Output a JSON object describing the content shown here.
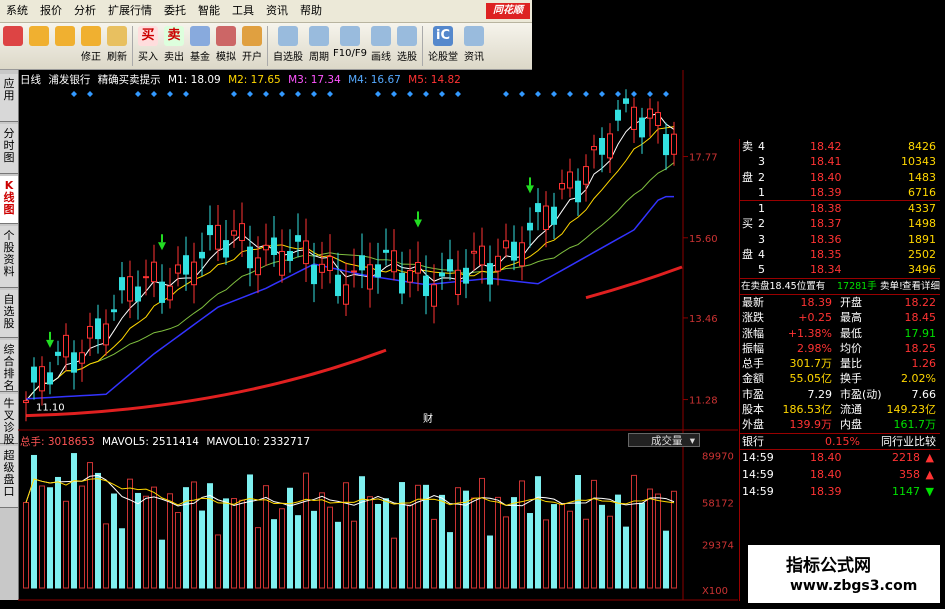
{
  "menu": [
    "系统",
    "报价",
    "分析",
    "扩展行情",
    "委托",
    "智能",
    "工具",
    "资讯",
    "帮助"
  ],
  "logo": "同花顺",
  "toolbar": [
    {
      "icon": "window-icon",
      "label": "",
      "color": "#d44"
    },
    {
      "icon": "back-arrow-icon",
      "label": "",
      "color": "#f0b030"
    },
    {
      "icon": "up-down-icon",
      "label": "",
      "color": "#f0b030"
    },
    {
      "icon": "modify-icon",
      "label": "修正",
      "color": "#f0b030"
    },
    {
      "icon": "clock-icon",
      "label": "刷新",
      "color": "#e8c060"
    },
    {
      "icon": "buy-icon",
      "label": "买入",
      "color": "#fdd",
      "text": "买"
    },
    {
      "icon": "sell-icon",
      "label": "卖出",
      "color": "#dfd",
      "text": "卖"
    },
    {
      "icon": "fund-icon",
      "label": "基金",
      "color": "#8ad"
    },
    {
      "icon": "hammer-icon",
      "label": "模拟",
      "color": "#c66"
    },
    {
      "icon": "lock-icon",
      "label": "开户",
      "color": "#e0a040"
    },
    {
      "icon": "star-icon",
      "label": "自选股",
      "color": "#9bd"
    },
    {
      "icon": "cycle-icon",
      "label": "周期",
      "color": "#9bd"
    },
    {
      "icon": "f10-icon",
      "label": "F10/F9",
      "color": "#9bd"
    },
    {
      "icon": "pen-icon",
      "label": "画线",
      "color": "#9bd"
    },
    {
      "icon": "select-stock-icon",
      "label": "选股",
      "color": "#9bd"
    },
    {
      "icon": "forum-icon",
      "label": "论股堂",
      "color": "#58c",
      "text": "iC"
    },
    {
      "icon": "news-icon",
      "label": "资讯",
      "color": "#9bd"
    }
  ],
  "left_tabs": [
    "应用",
    "分时图",
    "K线图",
    "个股资料",
    "自选股",
    "综合排名",
    "牛叉诊股",
    "超级盘口"
  ],
  "chart_header": {
    "period": "日线",
    "stock": "浦发银行",
    "indicator": "精确买卖提示",
    "m1": "M1: 18.09",
    "m2": "M2: 17.65",
    "m3": "M3: 17.34",
    "m4": "M4: 16.67",
    "m5": "M5: 14.82",
    "colors": {
      "m1": "#ffffff",
      "m2": "#ffd700",
      "m3": "#ff55ff",
      "m4": "#55aaff",
      "m5": "#ff3333"
    }
  },
  "price_axis": [
    "17.77",
    "15.60",
    "13.46",
    "11.28"
  ],
  "low_label": "11.10",
  "marker_cai": "财",
  "volume_header": {
    "total": "总手: 3018653",
    "mavol5": "MAVOL5: 2511414",
    "mavol10": "MAVOL10: 2332717",
    "dropdown": "成交量"
  },
  "volume_axis": [
    "89970",
    "58172",
    "29374",
    "X100"
  ],
  "order_book": {
    "sell": [
      {
        "side": "卖",
        "lvl": "4",
        "price": "18.42",
        "vol": "8426"
      },
      {
        "side": "",
        "lvl": "3",
        "price": "18.41",
        "vol": "10343"
      },
      {
        "side": "盘",
        "lvl": "2",
        "price": "18.40",
        "vol": "1483"
      },
      {
        "side": "",
        "lvl": "1",
        "price": "18.39",
        "vol": "6716"
      }
    ],
    "buy": [
      {
        "side": "",
        "lvl": "1",
        "price": "18.38",
        "vol": "4337"
      },
      {
        "side": "买",
        "lvl": "2",
        "price": "18.37",
        "vol": "1498"
      },
      {
        "side": "",
        "lvl": "3",
        "price": "18.36",
        "vol": "1891"
      },
      {
        "side": "盘",
        "lvl": "4",
        "price": "18.35",
        "vol": "2502"
      },
      {
        "side": "",
        "lvl": "5",
        "price": "18.34",
        "vol": "3496"
      }
    ],
    "status_text": "在卖盘18.45位置有",
    "status_vol": "17281手",
    "status_sell": "卖单!",
    "status_link": "查看详细"
  },
  "quote": [
    {
      "l1": "最新",
      "v1": "18.39",
      "l2": "开盘",
      "v2": "18.22",
      "c1": "red",
      "c2": "red"
    },
    {
      "l1": "涨跌",
      "v1": "+0.25",
      "l2": "最高",
      "v2": "18.45",
      "c1": "red",
      "c2": "red"
    },
    {
      "l1": "涨幅",
      "v1": "+1.38%",
      "l2": "最低",
      "v2": "17.91",
      "c1": "red",
      "c2": "grn"
    },
    {
      "l1": "振幅",
      "v1": "2.98%",
      "l2": "均价",
      "v2": "18.25",
      "c1": "red",
      "c2": "red"
    },
    {
      "l1": "总手",
      "v1": "301.7万",
      "l2": "量比",
      "v2": "1.26",
      "c1": "yel",
      "c2": "red"
    },
    {
      "l1": "金额",
      "v1": "55.05亿",
      "l2": "换手",
      "v2": "2.02%",
      "c1": "yel",
      "c2": "yel"
    },
    {
      "l1": "市盈",
      "v1": "7.29",
      "l2": "市盈(动)",
      "v2": "7.66",
      "c1": "wht",
      "c2": "wht"
    },
    {
      "l1": "股本",
      "v1": "186.53亿",
      "l2": "流通",
      "v2": "149.23亿",
      "c1": "yel",
      "c2": "yel"
    },
    {
      "l1": "外盘",
      "v1": "139.9万",
      "l2": "内盘",
      "v2": "161.7万",
      "c1": "red",
      "c2": "grn"
    }
  ],
  "industry": {
    "label": "银行",
    "pct": "0.15%",
    "btn": "同行业比较"
  },
  "ticks": [
    {
      "time": "14:59",
      "price": "18.40",
      "vol": "2218",
      "dir": "up"
    },
    {
      "time": "14:59",
      "price": "18.40",
      "vol": "358",
      "dir": "up"
    },
    {
      "time": "14:59",
      "price": "18.39",
      "vol": "1147",
      "dir": "down"
    }
  ],
  "watermark": {
    "title": "指标公式网",
    "url": "www.zbgs3.com"
  },
  "chart_data": {
    "type": "candlestick",
    "ylim": [
      10.6,
      19.2
    ],
    "axis_ticks": [
      17.77,
      15.6,
      13.46,
      11.28
    ],
    "low": 11.1,
    "volume_ylim": [
      0,
      95000
    ],
    "volume_ticks": [
      89970,
      58172,
      29374
    ],
    "ma_last": {
      "M1": 18.09,
      "M2": 17.65,
      "M3": 17.34,
      "M4": 16.67,
      "M5": 14.82
    },
    "volume_last": {
      "total": 3018653,
      "MAVOL5": 2511414,
      "MAVOL10": 2332717
    }
  }
}
